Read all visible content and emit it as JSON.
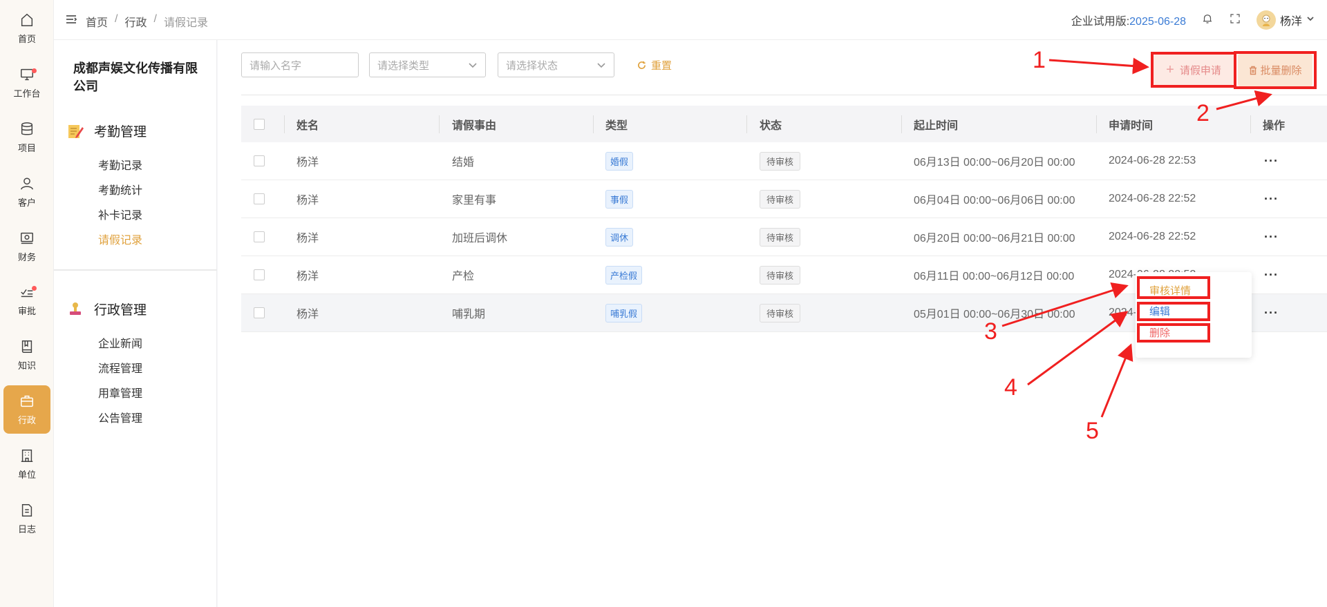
{
  "rail": [
    {
      "label": "首页",
      "icon": "home-icon",
      "dot": false
    },
    {
      "label": "工作台",
      "icon": "monitor-icon",
      "dot": true
    },
    {
      "label": "项目",
      "icon": "database-icon",
      "dot": false
    },
    {
      "label": "客户",
      "icon": "user-icon",
      "dot": false
    },
    {
      "label": "财务",
      "icon": "finance-icon",
      "dot": false
    },
    {
      "label": "审批",
      "icon": "approval-icon",
      "dot": true
    },
    {
      "label": "知识",
      "icon": "book-icon",
      "dot": false
    },
    {
      "label": "行政",
      "icon": "briefcase-icon",
      "dot": false,
      "active": true
    },
    {
      "label": "单位",
      "icon": "building-icon",
      "dot": false
    },
    {
      "label": "日志",
      "icon": "document-icon",
      "dot": false
    }
  ],
  "header": {
    "breadcrumb": [
      "首页",
      "行政",
      "请假记录"
    ],
    "trial_label": "企业试用版:",
    "trial_date": "2025-06-28",
    "username": "杨洋"
  },
  "subnav": {
    "company": "成都声娱文化传播有限公司",
    "groups": [
      {
        "title": "考勤管理",
        "items": [
          "考勤记录",
          "考勤统计",
          "补卡记录",
          "请假记录"
        ]
      },
      {
        "title": "行政管理",
        "items": [
          "企业新闻",
          "流程管理",
          "用章管理",
          "公告管理"
        ]
      }
    ]
  },
  "filters": {
    "name_placeholder": "请输入名字",
    "type_placeholder": "请选择类型",
    "status_placeholder": "请选择状态",
    "reset_label": "重置"
  },
  "actions": {
    "leave_request_label": "请假申请",
    "batch_delete_label": "批量删除"
  },
  "table": {
    "headers": [
      "姓名",
      "请假事由",
      "类型",
      "状态",
      "起止时间",
      "申请时间",
      "操作"
    ],
    "rows": [
      {
        "name": "杨洋",
        "reason": "结婚",
        "type": "婚假",
        "status": "待审核",
        "period": "06月13日 00:00~06月20日 00:00",
        "applied": "2024-06-28 22:53"
      },
      {
        "name": "杨洋",
        "reason": "家里有事",
        "type": "事假",
        "status": "待审核",
        "period": "06月04日 00:00~06月06日 00:00",
        "applied": "2024-06-28 22:52"
      },
      {
        "name": "杨洋",
        "reason": "加班后调休",
        "type": "调休",
        "status": "待审核",
        "period": "06月20日 00:00~06月21日 00:00",
        "applied": "2024-06-28 22:52"
      },
      {
        "name": "杨洋",
        "reason": "产检",
        "type": "产检假",
        "status": "待审核",
        "period": "06月11日 00:00~06月12日 00:00",
        "applied": "2024-06-28 22:52"
      },
      {
        "name": "杨洋",
        "reason": "哺乳期",
        "type": "哺乳假",
        "status": "待审核",
        "period": "05月01日 00:00~06月30日 00:00",
        "applied": "2024-06-28 22:52"
      }
    ]
  },
  "dropdown": {
    "detail_label": "审核详情",
    "edit_label": "编辑",
    "delete_label": "删除"
  },
  "annotations": [
    "1",
    "2",
    "3",
    "4",
    "5"
  ],
  "colors": {
    "accent": "#e0a23e",
    "active_rail": "#e6a74b",
    "link_blue": "#3a7bd5",
    "annotation_red": "#f02020"
  }
}
